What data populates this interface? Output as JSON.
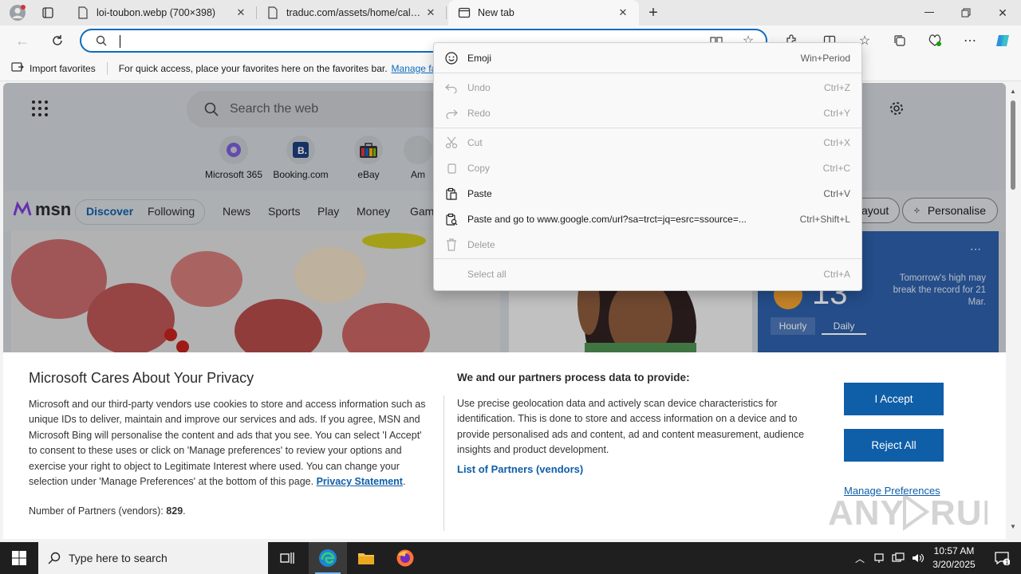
{
  "tabs": [
    {
      "title": "loi-toubon.webp (700×398)",
      "active": false
    },
    {
      "title": "traduc.com/assets/home/calend",
      "active": false
    },
    {
      "title": "New tab",
      "active": true
    }
  ],
  "omnibox": {
    "value": "",
    "placeholder": ""
  },
  "favorites_bar": {
    "import_label": "Import favorites",
    "hint": "For quick access, place your favorites here on the favorites bar.",
    "manage_link": "Manage favori"
  },
  "ntp": {
    "search_placeholder": "Search the web",
    "quick_links": [
      "Microsoft 365",
      "Booking.com",
      "eBay",
      "Am"
    ],
    "msn": {
      "logo": "msn",
      "nav": [
        "Discover",
        "Following",
        "News",
        "Sports",
        "Play",
        "Money",
        "Gam"
      ],
      "layout_label": "ayout",
      "personalise_label": "Personalise"
    },
    "weather": {
      "temp": "13",
      "tabs": [
        "Hourly",
        "Daily"
      ],
      "note": "Tomorrow's high may break the record for 21 Mar."
    }
  },
  "context_menu": [
    {
      "label": "Emoji",
      "shortcut": "Win+Period",
      "enabled": true,
      "icon": "emoji-icon"
    },
    {
      "label": "Undo",
      "shortcut": "Ctrl+Z",
      "enabled": false,
      "icon": "undo-icon"
    },
    {
      "label": "Redo",
      "shortcut": "Ctrl+Y",
      "enabled": false,
      "icon": "redo-icon"
    },
    {
      "label": "Cut",
      "shortcut": "Ctrl+X",
      "enabled": false,
      "icon": "cut-icon"
    },
    {
      "label": "Copy",
      "shortcut": "Ctrl+C",
      "enabled": false,
      "icon": "copy-icon"
    },
    {
      "label": "Paste",
      "shortcut": "Ctrl+V",
      "enabled": true,
      "icon": "paste-icon"
    },
    {
      "label": "Paste and go to www.google.com/url?sa=trct=jq=esrc=ssource=...",
      "shortcut": "Ctrl+Shift+L",
      "enabled": true,
      "icon": "paste-go-icon"
    },
    {
      "label": "Delete",
      "shortcut": "",
      "enabled": false,
      "icon": "delete-icon"
    },
    {
      "label": "Select all",
      "shortcut": "Ctrl+A",
      "enabled": false,
      "icon": ""
    }
  ],
  "privacy": {
    "title": "Microsoft Cares About Your Privacy",
    "body": "Microsoft and our third-party vendors use cookies to store and access information such as unique IDs to deliver, maintain and improve our services and ads. If you agree, MSN and Microsoft Bing will personalise the content and ads that you see. You can select 'I Accept' to consent to these uses or click on 'Manage preferences' to review your options and exercise your right to object to Legitimate Interest where used.  You can change your selection under 'Manage Preferences' at the bottom of this page.",
    "privacy_link": "Privacy Statement",
    "partners_label": "Number of Partners (vendors):",
    "partners_count": "829",
    "heading2": "We and our partners process data to provide:",
    "para2": "Use precise geolocation data and actively scan device characteristics for identification. This is done to store and access information on a device and to provide personalised ads and content, ad and content measurement, audience insights and product development.",
    "partners_link": "List of Partners (vendors)",
    "accept": "I Accept",
    "reject": "Reject All",
    "manage": "Manage Preferences",
    "watermark": "ANY RUN"
  },
  "taskbar": {
    "search_placeholder": "Type here to search",
    "time": "10:57 AM",
    "date": "3/20/2025",
    "notification_count": "1"
  },
  "colors": {
    "accent": "#0f6cbd",
    "msn_blue": "#0f5ea8",
    "taskbar": "#1f1f1f"
  }
}
